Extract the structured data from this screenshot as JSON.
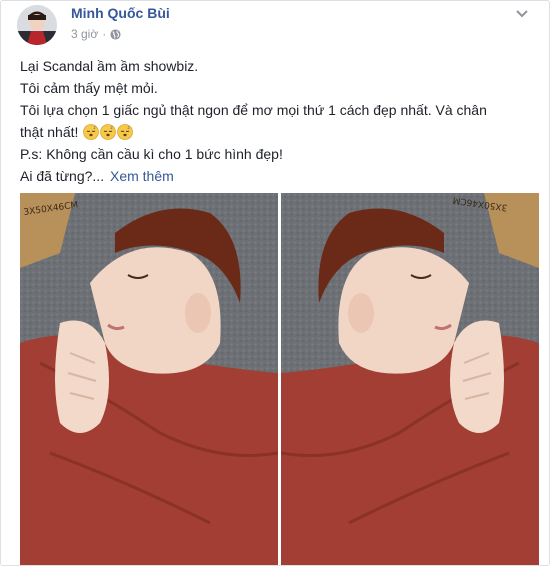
{
  "post": {
    "author": "Minh Quốc Bùi",
    "time": "3 giờ",
    "separator": "·",
    "privacy_icon": "globe-icon",
    "options_icon": "chevron-down-icon",
    "lines": [
      "Lại Scandal ầm ầm showbiz.",
      "Tôi cảm thấy mệt mỏi.",
      "Tôi lựa chọn 1 giấc ngủ thật ngon để mơ mọi thứ 1 cách đẹp nhất. Và chân",
      "thật nhất!",
      "P.s: Không cần cầu kì cho 1 bức hình đẹp!",
      "Ai đã từng?..."
    ],
    "see_more": "Xem thêm",
    "emoji_icon": "sleeping-face-icon",
    "emoji_count": 3
  },
  "photo": {
    "box_text": "3X50X46CM",
    "description_icon": "sleeping-man-photo"
  },
  "colors": {
    "link": "#365899",
    "meta": "#90949c",
    "sweater": "#a23e34",
    "hair": "#6b2a18",
    "skin": "#f1d6c6",
    "carpet": "#6f7378"
  }
}
